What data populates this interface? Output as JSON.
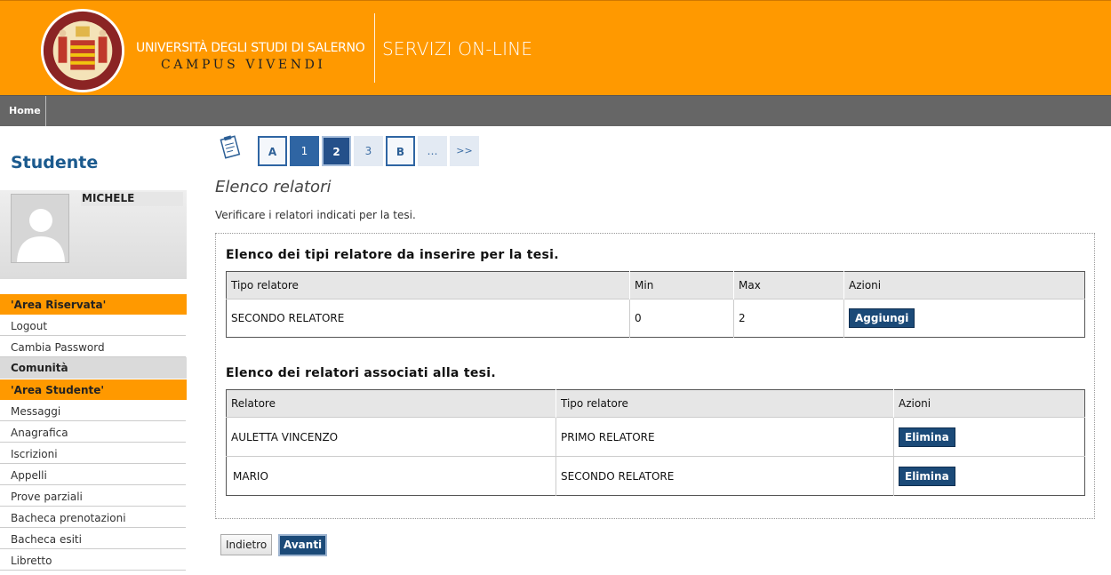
{
  "header": {
    "university": "UNIVERSITÀ DEGLI STUDI DI SALERNO",
    "motto": "CAMPUS VIVENDI",
    "services": "SERVIZI ON-LINE",
    "colors": {
      "brand": "#ff9900",
      "nav": "#666666",
      "accent": "#1b4a78"
    }
  },
  "nav": {
    "home": "Home"
  },
  "sidebar": {
    "title": "Studente",
    "user_name": "MICHELE",
    "sections": [
      {
        "label": "'Area Riservata'",
        "items": [
          "Logout",
          "Cambia Password"
        ]
      },
      {
        "label": "Comunità",
        "items": []
      },
      {
        "label": "'Area Studente'",
        "items": [
          "Messaggi",
          "Anagrafica",
          "Iscrizioni",
          "Appelli",
          "Prove parziali",
          "Bacheca prenotazioni",
          "Bacheca esiti",
          "Libretto"
        ]
      }
    ]
  },
  "wizard": {
    "icon": "clipboard-icon",
    "steps": [
      "A",
      "1",
      "2",
      "3",
      "B",
      "…",
      ">>"
    ],
    "current": "2"
  },
  "main": {
    "title": "Elenco relatori",
    "description": "Verificare i relatori indicati per la tesi.",
    "types_section": {
      "title": "Elenco dei tipi relatore da inserire per la tesi.",
      "columns": [
        "Tipo relatore",
        "Min",
        "Max",
        "Azioni"
      ],
      "rows": [
        {
          "tipo": "SECONDO RELATORE",
          "min": "0",
          "max": "2",
          "action": "Aggiungi"
        }
      ]
    },
    "assoc_section": {
      "title": "Elenco dei relatori associati alla tesi.",
      "columns": [
        "Relatore",
        "Tipo relatore",
        "Azioni"
      ],
      "rows": [
        {
          "relatore": "AULETTA VINCENZO",
          "tipo": "PRIMO RELATORE",
          "action": "Elimina"
        },
        {
          "relatore": "MARIO",
          "tipo": "SECONDO RELATORE",
          "action": "Elimina"
        }
      ]
    },
    "back_label": "Indietro",
    "next_label": "Avanti"
  }
}
